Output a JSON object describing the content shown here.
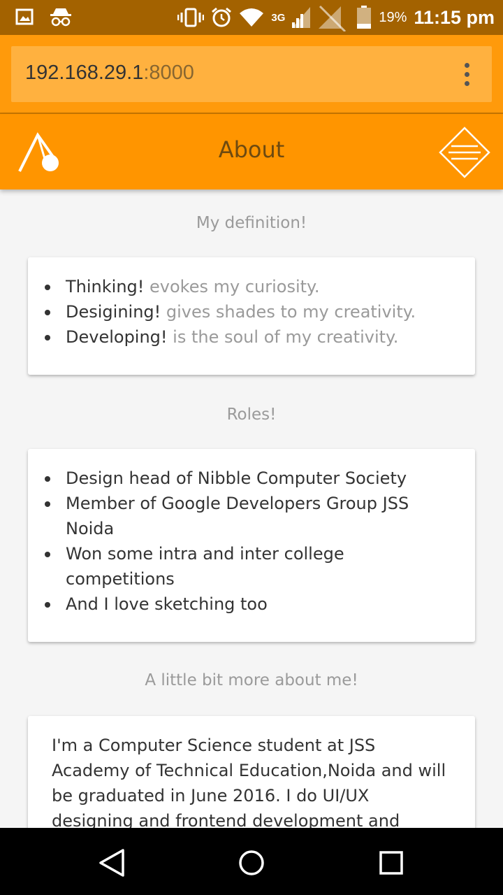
{
  "status_bar": {
    "network": "3G",
    "battery": "19%",
    "time": "11:15 pm",
    "icons": [
      "gallery-icon",
      "incognito-icon",
      "vibrate-icon",
      "alarm-icon",
      "wifi-icon",
      "signal-icon",
      "no-signal-icon",
      "battery-icon"
    ]
  },
  "browser": {
    "url_host": "192.168.29.1",
    "url_port": ":8000",
    "menu_icon": "more-vert-icon"
  },
  "header": {
    "title": "About",
    "logo_icon": "music-note-logo-icon",
    "menu_icon": "diamond-menu-icon",
    "color": "#ff9500"
  },
  "sections": {
    "definition": {
      "heading": "My definition!",
      "items": [
        {
          "strong": "Thinking!",
          "rest": " evokes my curiosity."
        },
        {
          "strong": "Desigining!",
          "rest": " gives shades to my creativity."
        },
        {
          "strong": "Developing!",
          "rest": " is the soul of my creativity."
        }
      ]
    },
    "roles": {
      "heading": "Roles!",
      "items": [
        "Design head of Nibble Computer Society",
        "Member of Google Developers Group JSS Noida",
        "Won some intra and inter college competitions",
        "And I love sketching too"
      ]
    },
    "about": {
      "heading": "A little bit more about me!",
      "text": "I'm a Computer Science student at JSS Academy of Technical Education,Noida and will be graduated in June 2016. I do UI/UX designing and frontend development and"
    }
  },
  "nav": {
    "back_icon": "back-triangle-icon",
    "home_icon": "home-circle-icon",
    "recents_icon": "recents-square-icon"
  }
}
